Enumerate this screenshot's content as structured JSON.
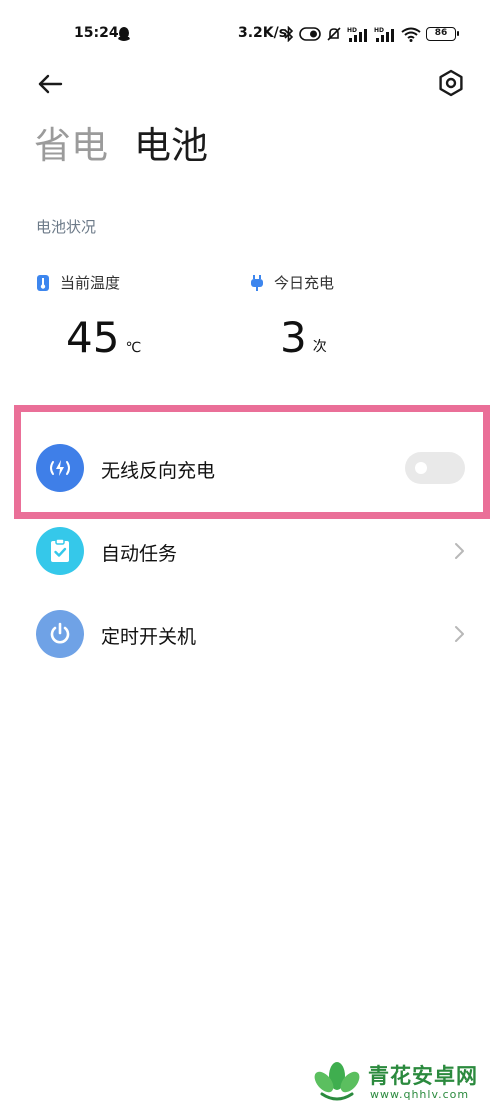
{
  "status_bar": {
    "time": "15:24",
    "speed": "3.2K/s",
    "battery": "86",
    "icons": [
      "qq-icon",
      "bluetooth-icon",
      "toggle-icon",
      "mute-icon",
      "signal-hd-icon",
      "signal-hd-icon",
      "wifi-icon",
      "battery-icon"
    ]
  },
  "header": {
    "back_icon": "arrow-left-icon",
    "settings_icon": "gear-icon"
  },
  "tabs": [
    {
      "label": "省电",
      "active": false
    },
    {
      "label": "电池",
      "active": true
    }
  ],
  "battery_status": {
    "section_title": "电池状况",
    "temperature": {
      "label": "当前温度",
      "value": "45",
      "unit": "℃",
      "icon": "thermometer-icon"
    },
    "charges": {
      "label": "今日充电",
      "value": "3",
      "unit": "次",
      "icon": "plug-icon"
    }
  },
  "list": {
    "items": [
      {
        "label": "无线反向充电",
        "icon": "wireless-charge-icon",
        "color": "#3f7fe8",
        "control": "toggle",
        "enabled": false
      },
      {
        "label": "自动任务",
        "icon": "clipboard-icon",
        "color": "#35c8ea",
        "control": "chevron"
      },
      {
        "label": "定时开关机",
        "icon": "power-icon",
        "color": "#6fa2e6",
        "control": "chevron"
      }
    ]
  },
  "highlight_color": "#ea6f98",
  "watermark": {
    "name": "青花安卓网",
    "url": "www.qhhlv.com"
  }
}
